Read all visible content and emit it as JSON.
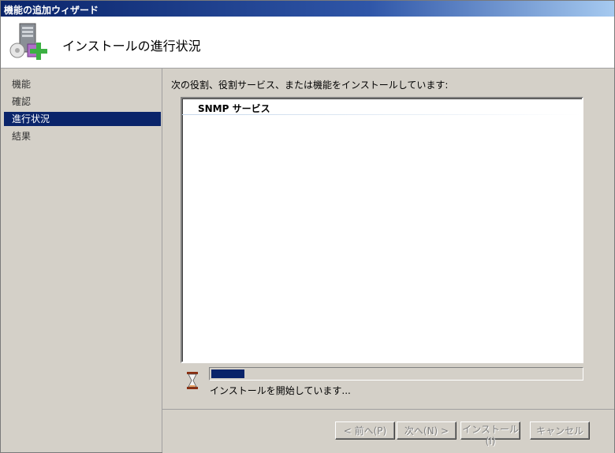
{
  "window": {
    "title": "機能の追加ウィザード"
  },
  "header": {
    "title": "インストールの進行状況",
    "icon": "server-add-icon"
  },
  "sidebar": {
    "items": [
      {
        "label": "機能",
        "selected": false
      },
      {
        "label": "確認",
        "selected": false
      },
      {
        "label": "進行状況",
        "selected": true
      },
      {
        "label": "結果",
        "selected": false
      }
    ]
  },
  "main": {
    "description": "次の役割、役割サービス、または機能をインストールしています:",
    "list": [
      "SNMP サービス"
    ],
    "progress_fraction": 0.09,
    "status": "インストールを開始しています..."
  },
  "footer": {
    "prev_label": "< 前へ(P)",
    "next_label": "次へ(N) >",
    "install_label": "インストール(I)",
    "cancel_label": "キャンセル"
  },
  "colors": {
    "title_bar": "#0a246a",
    "selection": "#0a246a",
    "progress": "#0a246a"
  }
}
